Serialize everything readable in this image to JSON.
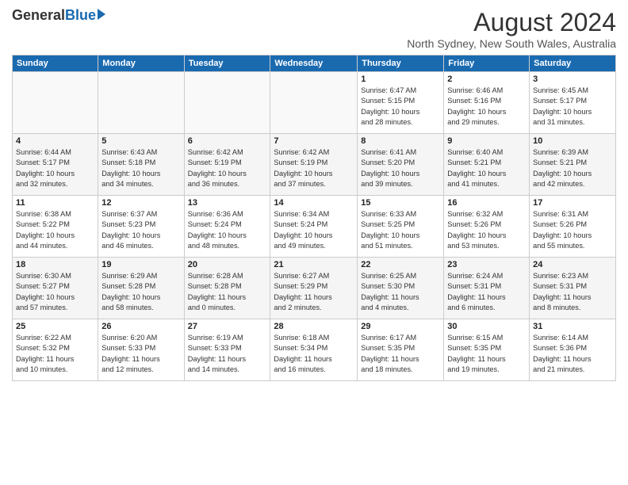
{
  "logo": {
    "general": "General",
    "blue": "Blue"
  },
  "title": "August 2024",
  "location": "North Sydney, New South Wales, Australia",
  "headers": [
    "Sunday",
    "Monday",
    "Tuesday",
    "Wednesday",
    "Thursday",
    "Friday",
    "Saturday"
  ],
  "weeks": [
    [
      {
        "day": "",
        "info": ""
      },
      {
        "day": "",
        "info": ""
      },
      {
        "day": "",
        "info": ""
      },
      {
        "day": "",
        "info": ""
      },
      {
        "day": "1",
        "info": "Sunrise: 6:47 AM\nSunset: 5:15 PM\nDaylight: 10 hours\nand 28 minutes."
      },
      {
        "day": "2",
        "info": "Sunrise: 6:46 AM\nSunset: 5:16 PM\nDaylight: 10 hours\nand 29 minutes."
      },
      {
        "day": "3",
        "info": "Sunrise: 6:45 AM\nSunset: 5:17 PM\nDaylight: 10 hours\nand 31 minutes."
      }
    ],
    [
      {
        "day": "4",
        "info": "Sunrise: 6:44 AM\nSunset: 5:17 PM\nDaylight: 10 hours\nand 32 minutes."
      },
      {
        "day": "5",
        "info": "Sunrise: 6:43 AM\nSunset: 5:18 PM\nDaylight: 10 hours\nand 34 minutes."
      },
      {
        "day": "6",
        "info": "Sunrise: 6:42 AM\nSunset: 5:19 PM\nDaylight: 10 hours\nand 36 minutes."
      },
      {
        "day": "7",
        "info": "Sunrise: 6:42 AM\nSunset: 5:19 PM\nDaylight: 10 hours\nand 37 minutes."
      },
      {
        "day": "8",
        "info": "Sunrise: 6:41 AM\nSunset: 5:20 PM\nDaylight: 10 hours\nand 39 minutes."
      },
      {
        "day": "9",
        "info": "Sunrise: 6:40 AM\nSunset: 5:21 PM\nDaylight: 10 hours\nand 41 minutes."
      },
      {
        "day": "10",
        "info": "Sunrise: 6:39 AM\nSunset: 5:21 PM\nDaylight: 10 hours\nand 42 minutes."
      }
    ],
    [
      {
        "day": "11",
        "info": "Sunrise: 6:38 AM\nSunset: 5:22 PM\nDaylight: 10 hours\nand 44 minutes."
      },
      {
        "day": "12",
        "info": "Sunrise: 6:37 AM\nSunset: 5:23 PM\nDaylight: 10 hours\nand 46 minutes."
      },
      {
        "day": "13",
        "info": "Sunrise: 6:36 AM\nSunset: 5:24 PM\nDaylight: 10 hours\nand 48 minutes."
      },
      {
        "day": "14",
        "info": "Sunrise: 6:34 AM\nSunset: 5:24 PM\nDaylight: 10 hours\nand 49 minutes."
      },
      {
        "day": "15",
        "info": "Sunrise: 6:33 AM\nSunset: 5:25 PM\nDaylight: 10 hours\nand 51 minutes."
      },
      {
        "day": "16",
        "info": "Sunrise: 6:32 AM\nSunset: 5:26 PM\nDaylight: 10 hours\nand 53 minutes."
      },
      {
        "day": "17",
        "info": "Sunrise: 6:31 AM\nSunset: 5:26 PM\nDaylight: 10 hours\nand 55 minutes."
      }
    ],
    [
      {
        "day": "18",
        "info": "Sunrise: 6:30 AM\nSunset: 5:27 PM\nDaylight: 10 hours\nand 57 minutes."
      },
      {
        "day": "19",
        "info": "Sunrise: 6:29 AM\nSunset: 5:28 PM\nDaylight: 10 hours\nand 58 minutes."
      },
      {
        "day": "20",
        "info": "Sunrise: 6:28 AM\nSunset: 5:28 PM\nDaylight: 11 hours\nand 0 minutes."
      },
      {
        "day": "21",
        "info": "Sunrise: 6:27 AM\nSunset: 5:29 PM\nDaylight: 11 hours\nand 2 minutes."
      },
      {
        "day": "22",
        "info": "Sunrise: 6:25 AM\nSunset: 5:30 PM\nDaylight: 11 hours\nand 4 minutes."
      },
      {
        "day": "23",
        "info": "Sunrise: 6:24 AM\nSunset: 5:31 PM\nDaylight: 11 hours\nand 6 minutes."
      },
      {
        "day": "24",
        "info": "Sunrise: 6:23 AM\nSunset: 5:31 PM\nDaylight: 11 hours\nand 8 minutes."
      }
    ],
    [
      {
        "day": "25",
        "info": "Sunrise: 6:22 AM\nSunset: 5:32 PM\nDaylight: 11 hours\nand 10 minutes."
      },
      {
        "day": "26",
        "info": "Sunrise: 6:20 AM\nSunset: 5:33 PM\nDaylight: 11 hours\nand 12 minutes."
      },
      {
        "day": "27",
        "info": "Sunrise: 6:19 AM\nSunset: 5:33 PM\nDaylight: 11 hours\nand 14 minutes."
      },
      {
        "day": "28",
        "info": "Sunrise: 6:18 AM\nSunset: 5:34 PM\nDaylight: 11 hours\nand 16 minutes."
      },
      {
        "day": "29",
        "info": "Sunrise: 6:17 AM\nSunset: 5:35 PM\nDaylight: 11 hours\nand 18 minutes."
      },
      {
        "day": "30",
        "info": "Sunrise: 6:15 AM\nSunset: 5:35 PM\nDaylight: 11 hours\nand 19 minutes."
      },
      {
        "day": "31",
        "info": "Sunrise: 6:14 AM\nSunset: 5:36 PM\nDaylight: 11 hours\nand 21 minutes."
      }
    ]
  ]
}
